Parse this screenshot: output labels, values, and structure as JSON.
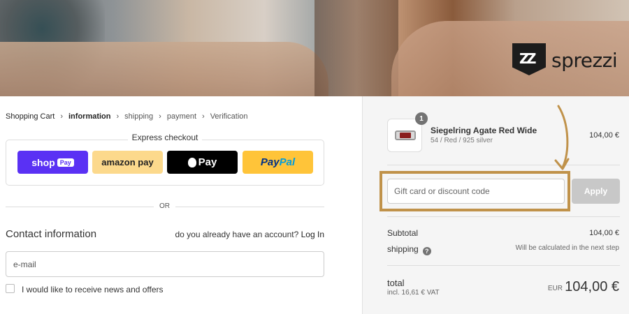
{
  "brand": {
    "name": "sprezzi",
    "mark": "Z"
  },
  "breadcrumb": [
    "Shopping Cart",
    "information",
    "shipping",
    "payment",
    "Verification"
  ],
  "express": {
    "title": "Express checkout",
    "shop_pay": "shop",
    "shop_pay_pill": "Pay",
    "amazon_pay": "amazon pay",
    "apple_pay": "Pay",
    "paypal_1": "Pay",
    "paypal_2": "Pal"
  },
  "separator": "OR",
  "contact": {
    "title": "Contact information",
    "account_prompt": "do you already have an account?",
    "login_link": "Log In",
    "email_placeholder": "e-mail",
    "newsletter_label": "I would like to receive news and offers"
  },
  "cart": {
    "quantity": "1",
    "product_name": "Siegelring Agate Red Wide",
    "product_variant": "54 / Red / 925 silver",
    "product_price": "104,00 €"
  },
  "discount": {
    "placeholder": "Gift card or discount code",
    "apply_label": "Apply"
  },
  "summary": {
    "subtotal_label": "Subtotal",
    "subtotal_value": "104,00 €",
    "shipping_label": "shipping",
    "shipping_help": "?",
    "shipping_value": "Will be calculated in the next step",
    "total_label": "total",
    "total_vat": "incl. 16,61 € VAT",
    "total_currency": "EUR",
    "total_value": "104,00 €"
  },
  "colors": {
    "highlight": "#c0924a",
    "shop_pay": "#5a31f4",
    "amazon_pay": "#fcd98c",
    "paypal": "#ffc439"
  }
}
